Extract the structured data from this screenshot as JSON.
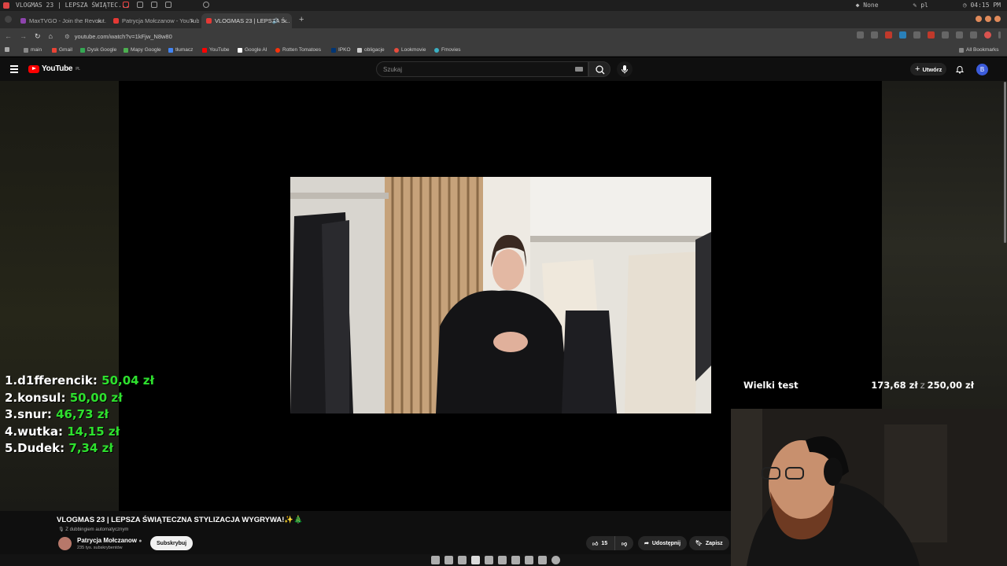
{
  "system_bar": {
    "window_title": "VLOGMAS 23 | LEPSZA ŚWIĄTEC...",
    "status_none": "None",
    "layout": "pl",
    "clock": "04:15 PM"
  },
  "tabs": [
    {
      "label": "MaxTVGO - Join the Revolut...",
      "close": "×"
    },
    {
      "label": "Patrycja Mołczanow - YouTub...",
      "close": "×"
    },
    {
      "label": "VLOGMAS 23 | LEPSZA Ś...",
      "close": "×",
      "active": true,
      "audio": "🔊"
    }
  ],
  "new_tab": "+",
  "address": {
    "url": "youtube.com/watch?v=1kFjw_N8w80",
    "back": "←",
    "forward": "→",
    "reload": "↻",
    "home": "⌂"
  },
  "bookmarks": [
    {
      "label": "main"
    },
    {
      "label": "Gmail"
    },
    {
      "label": "Dysk Google"
    },
    {
      "label": "Mapy Google"
    },
    {
      "label": "tłumacz"
    },
    {
      "label": "YouTube"
    },
    {
      "label": "Google AI"
    },
    {
      "label": "Rotten Tomatoes"
    },
    {
      "label": "IPKO"
    },
    {
      "label": "obligacje"
    },
    {
      "label": "Lookmovie"
    },
    {
      "label": "Fmovies"
    }
  ],
  "all_bookmarks": "All Bookmarks",
  "youtube": {
    "logo_text": "YouTube",
    "region": "PL",
    "search_placeholder": "Szukaj",
    "create_label": "Utwórz",
    "avatar_letter": "B"
  },
  "leaderboard": [
    {
      "rank": "1.",
      "name": "d1fferencik:",
      "amount": "50,04 zł"
    },
    {
      "rank": "2.",
      "name": "konsul:",
      "amount": "50,00 zł"
    },
    {
      "rank": "3.",
      "name": "snur:",
      "amount": "46,73 zł"
    },
    {
      "rank": "4.",
      "name": "wutka:",
      "amount": "14,15 zł"
    },
    {
      "rank": "5.",
      "name": "Dudek:",
      "amount": "7,34 zł"
    }
  ],
  "goal": {
    "title": "Wielki test",
    "current": "173,68 zł",
    "separator": "z",
    "target": "250,00 zł"
  },
  "video": {
    "title": "VLOGMAS 23 | LEPSZA ŚWIĄTECZNA STYLIZACJA WYGRYWA!✨🎄",
    "dubbing": "Z dubbingiem automatycznym",
    "channel": "Patrycja Mołczanow",
    "subscribers": "235 tys. subskrybentów",
    "subscribe_label": "Subskrybuj",
    "likes": "15",
    "share_label": "Udostępnij",
    "save_label": "Zapisz"
  }
}
